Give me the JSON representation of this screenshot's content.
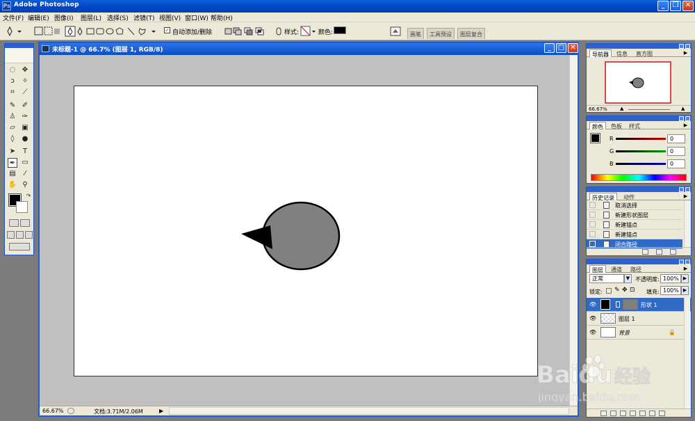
{
  "app": {
    "title": "Adobe Photoshop",
    "icon_name": "photoshop-icon",
    "window_buttons": [
      "minimize-icon",
      "restore-icon",
      "close-icon"
    ]
  },
  "menu": [
    "文件(F)",
    "编辑(E)",
    "图像(I)",
    "图层(L)",
    "选择(S)",
    "滤镜(T)",
    "视图(V)",
    "窗口(W)",
    "帮助(H)"
  ],
  "options_bar": {
    "auto_add_delete_label": "自动添加/删除",
    "auto_add_delete_checked": true,
    "style_label": "样式:",
    "color_label": "颜色:",
    "color_value": "#000000",
    "wells": [
      "画笔",
      "工具预设",
      "图层复合"
    ]
  },
  "document": {
    "title": "未标题-1 @ 66.7% (图层 1, RGB/8)",
    "zoom": "66.67%",
    "doc_info": "文档:3.71M/2.06M",
    "shape_fill": "#808080",
    "shape_stroke": "#000000"
  },
  "toolbox": {
    "foreground": "#000000",
    "background": "#ffffff"
  },
  "navigator": {
    "tabs": [
      "导航器",
      "信息",
      "直方图"
    ],
    "zoom": "66.67%"
  },
  "color_panel": {
    "tabs": [
      "颜色",
      "色板",
      "样式"
    ],
    "channels": [
      {
        "label": "R",
        "value": "0",
        "color": "#c00000"
      },
      {
        "label": "G",
        "value": "0",
        "color": "#00a000"
      },
      {
        "label": "B",
        "value": "0",
        "color": "#0000c0"
      }
    ]
  },
  "history_panel": {
    "tabs": [
      "历史记录",
      "动作"
    ],
    "items": [
      "取消选择",
      "新建形状图层",
      "新建锚点",
      "新建锚点",
      "闭合路径"
    ],
    "selected_index": 4
  },
  "layers_panel": {
    "tabs": [
      "图层",
      "通道",
      "路径"
    ],
    "blend_mode": "正常",
    "opacity_label": "不透明度:",
    "opacity": "100%",
    "lock_label": "锁定:",
    "fill_label": "填充:",
    "fill": "100%",
    "layers": [
      {
        "name": "形状 1",
        "selected": true
      },
      {
        "name": "图层 1",
        "selected": false
      },
      {
        "name": "背景",
        "selected": false
      }
    ]
  },
  "watermark": {
    "brand": "Baidu",
    "brand_cn": "经验",
    "url": "jingyan.baidu.com"
  }
}
